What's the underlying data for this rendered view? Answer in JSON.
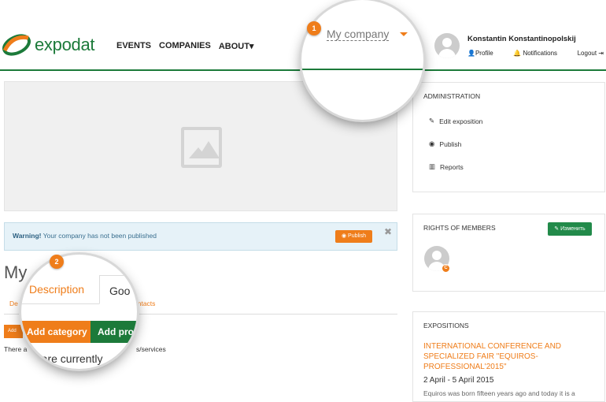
{
  "brand": {
    "name": "expodat",
    "color_green": "#1c7a3a",
    "color_orange": "#ef7d1a"
  },
  "nav": {
    "items": [
      "EVENTS",
      "COMPANIES",
      "ABOUT▾"
    ]
  },
  "company_menu": {
    "label": "My company",
    "step": "1"
  },
  "user": {
    "name": "Konstantin Konstantinopolskij",
    "profile": "Profile",
    "notifications": "Notifications",
    "logout": "Logout"
  },
  "warning": {
    "bold": "Warning!",
    "text": " Your company has not been published",
    "button": "Publish"
  },
  "company": {
    "title_partial": "My",
    "step": "2"
  },
  "tabs": {
    "description": "Description",
    "goods_partial": "Goo",
    "description_small": "De",
    "contacts_partial": "ontacts"
  },
  "actions": {
    "add_small": "Add",
    "add_category": "Add category",
    "add_product": "Add pro"
  },
  "empty": {
    "text_start": "There a",
    "text_mag": "e are currently",
    "text_end": "s/services"
  },
  "admin": {
    "title": "ADMINISTRATION",
    "items": [
      {
        "label": "Edit exposition",
        "icon": "pencil-icon"
      },
      {
        "label": "Publish",
        "icon": "eye-icon"
      },
      {
        "label": "Reports",
        "icon": "bar-chart-icon"
      }
    ]
  },
  "rights": {
    "title": "RIGHTS OF MEMBERS",
    "button": "Изменить",
    "badge": "C"
  },
  "expositions": {
    "title": "EXPOSITIONS",
    "event_title": "INTERNATIONAL CONFERENCE AND SPECIALIZED FAIR \"EQUIROS-PROFESSIONAL'2015\"",
    "event_date": "2 April - 5 April 2015",
    "event_desc": "Equiros was born fifteen years ago and today it is a"
  }
}
